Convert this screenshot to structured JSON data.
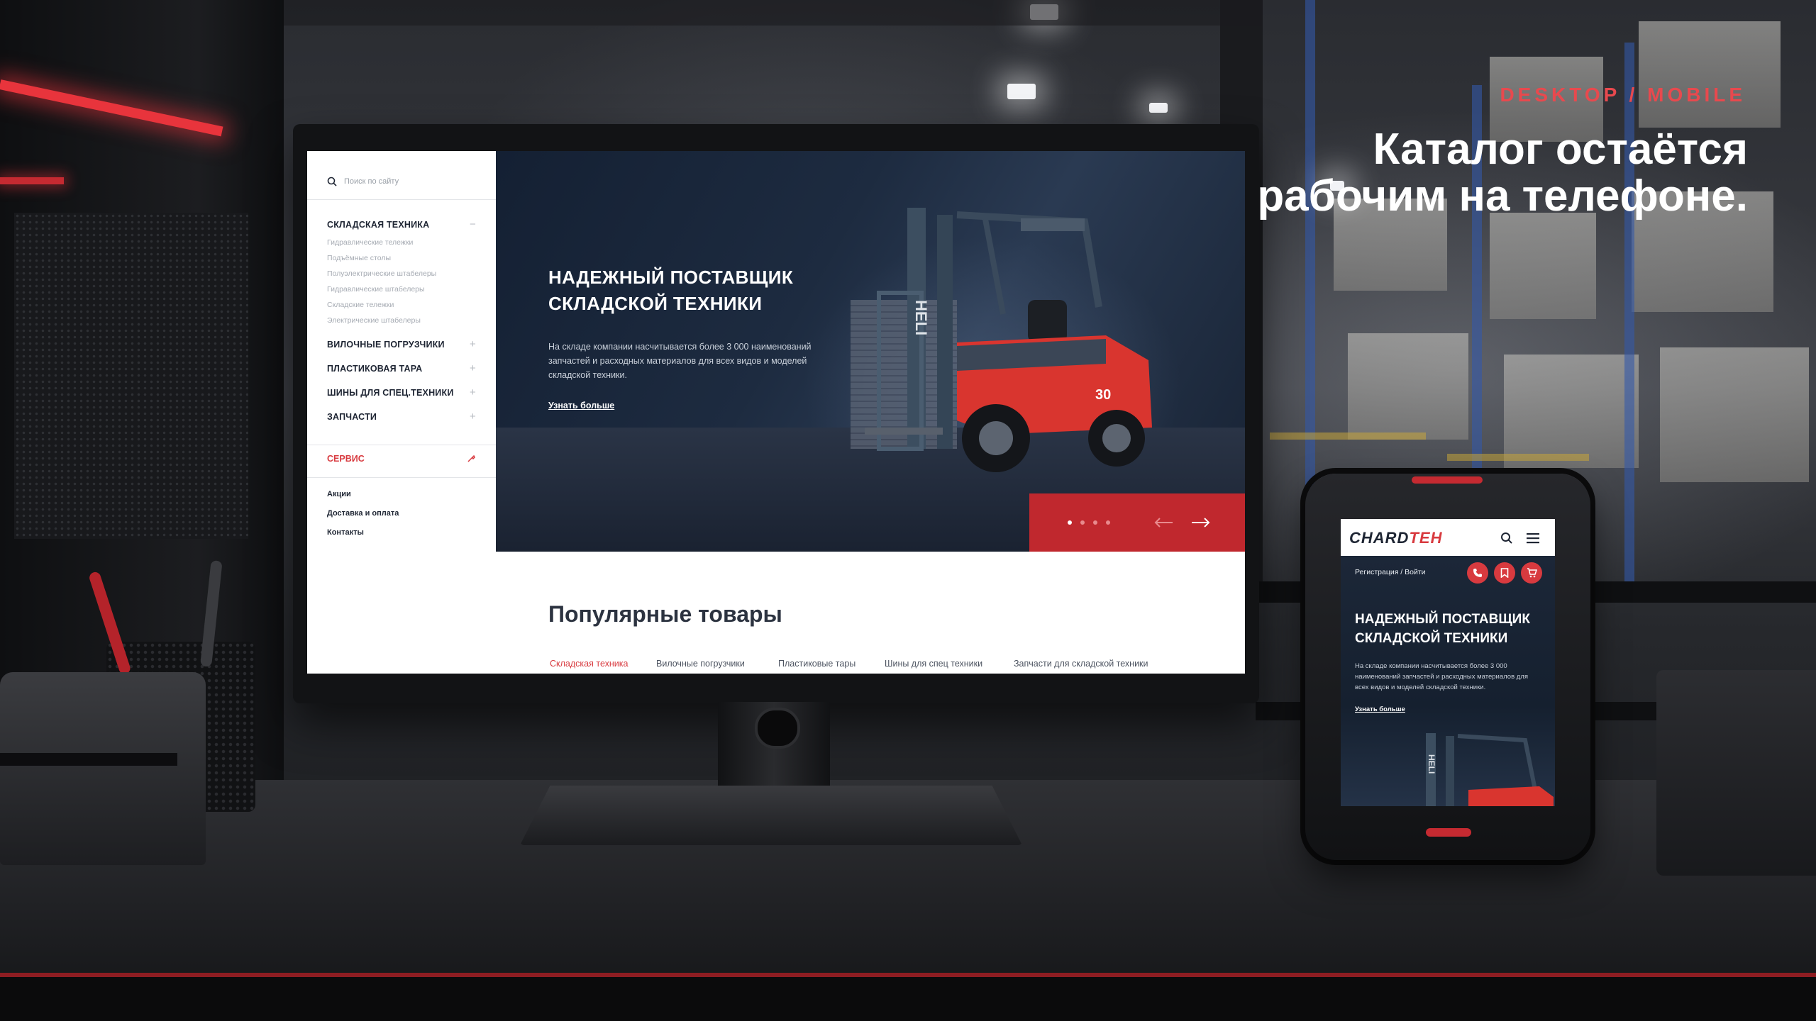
{
  "overlay": {
    "kicker": "DESKTOP / MOBILE",
    "caption": "Каталог остаётся рабочим на телефоне."
  },
  "desktop": {
    "search_placeholder": "Поиск по сайту",
    "categories": [
      {
        "label": "СКЛАДСКАЯ ТЕХНИКА",
        "sign": "−"
      },
      {
        "label": "ВИЛОЧНЫЕ ПОГРУЗЧИКИ",
        "sign": "+"
      },
      {
        "label": "ПЛАСТИКОВАЯ ТАРА",
        "sign": "+"
      },
      {
        "label": "ШИНЫ ДЛЯ СПЕЦ.ТЕХНИКИ",
        "sign": "+"
      },
      {
        "label": "ЗАПЧАСТИ",
        "sign": "+"
      }
    ],
    "subcategories": [
      "Гидравлические тележки",
      "Подъёмные столы",
      "Полуэлектрические штабелеры",
      "Гидравлические штабелеры",
      "Складские тележки",
      "Электрические штабелеры"
    ],
    "service": "СЕРВИС",
    "links": [
      "Акции",
      "Доставка и оплата",
      "Контакты"
    ],
    "hero": {
      "title": "НАДЕЖНЫЙ ПОСТАВЩИК СКЛАДСКОЙ ТЕХНИКИ",
      "text": "На складе компании насчитывается более 3 000 наименований запчастей и расходных материалов для всех видов и моделей складской техники.",
      "link": "Узнать больше",
      "forklift_brand": "HELI",
      "forklift_model": "30"
    },
    "popular": {
      "title": "Популярные товары",
      "tabs": [
        "Складская техника",
        "Вилочные погрузчики",
        "Пластиковые тары",
        "Шины для спец техники",
        "Запчасти для складской техники"
      ]
    }
  },
  "mobile": {
    "logo_left": "CHARD",
    "logo_right": "TEH",
    "auth": "Регистрация  /  Войти",
    "title": "НАДЕЖНЫЙ ПОСТАВЩИК СКЛАДСКОЙ ТЕХНИКИ",
    "text": "На складе компании насчитывается более 3 000 наименований запчастей и расходных материалов для всех видов и моделей складской техники.",
    "link": "Узнать больше",
    "forklift_brand": "HELI"
  },
  "colors": {
    "accent": "#d83a3f",
    "navy": "#1c2738",
    "text_dark": "#1e2533"
  }
}
